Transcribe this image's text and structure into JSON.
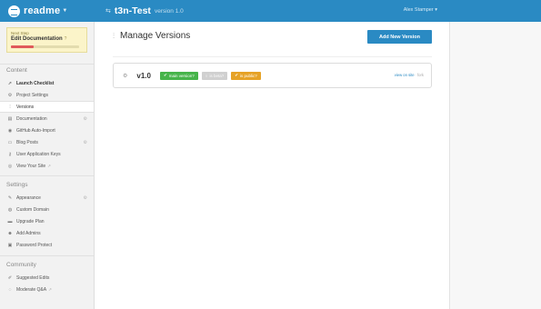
{
  "topbar": {
    "brand": "readme",
    "project_title": "t3n-Test",
    "project_version": "version 1.0",
    "user": "Alex Stamper"
  },
  "next_step": {
    "label": "Next Step",
    "title": "Edit Documentation",
    "progress": 0.33
  },
  "sidebar": {
    "content_heading": "Content",
    "content_items": [
      {
        "label": "Launch Checklist",
        "icon": "rocket-icon"
      },
      {
        "label": "Project Settings",
        "icon": "gear-icon"
      },
      {
        "label": "Versions",
        "icon": "sitemap-icon"
      },
      {
        "label": "Documentation",
        "icon": "doc-icon"
      },
      {
        "label": "GitHub Auto-Import",
        "icon": "github-icon"
      },
      {
        "label": "Blog Posts",
        "icon": "blog-icon"
      },
      {
        "label": "User Application Keys",
        "icon": "key-icon"
      },
      {
        "label": "View Your Site",
        "icon": "eye-icon"
      }
    ],
    "settings_heading": "Settings",
    "settings_items": [
      {
        "label": "Appearance",
        "icon": "brush-icon"
      },
      {
        "label": "Custom Domain",
        "icon": "globe-icon"
      },
      {
        "label": "Upgrade Plan",
        "icon": "card-icon"
      },
      {
        "label": "Add Admins",
        "icon": "users-icon"
      },
      {
        "label": "Password Protect",
        "icon": "lock-icon"
      }
    ],
    "community_heading": "Community",
    "community_items": [
      {
        "label": "Suggested Edits",
        "icon": "edit-icon"
      },
      {
        "label": "Moderate Q&A",
        "icon": "chat-icon"
      }
    ]
  },
  "main": {
    "title": "Manage Versions",
    "add_button": "Add New Version",
    "versions": [
      {
        "name": "v1.0",
        "badge_main": "main version?",
        "badge_beta": "is beta?",
        "badge_public": "is public?",
        "link_view": "view on site",
        "link_fork": "fork"
      }
    ]
  },
  "colors": {
    "brand_blue": "#2a8ac3",
    "badge_green": "#46b44a",
    "badge_orange": "#e6a226",
    "next_step_bg": "#fbf4c9"
  }
}
